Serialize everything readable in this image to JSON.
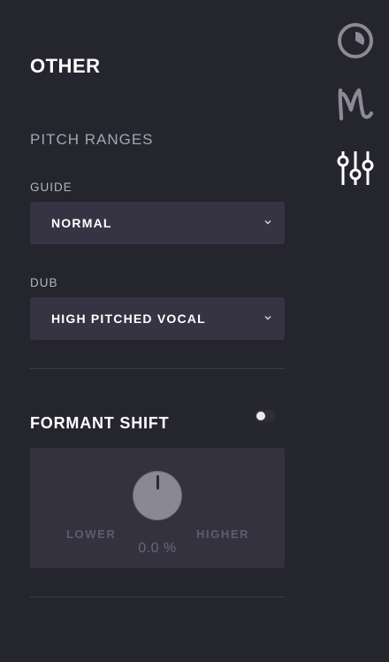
{
  "panel": {
    "title": "OTHER"
  },
  "pitch_ranges": {
    "title": "PITCH RANGES",
    "guide": {
      "label": "GUIDE",
      "value": "NORMAL"
    },
    "dub": {
      "label": "DUB",
      "value": "HIGH PITCHED VOCAL"
    }
  },
  "formant_shift": {
    "title": "FORMANT SHIFT",
    "enabled": false,
    "lower_label": "LOWER",
    "higher_label": "HIGHER",
    "value": "0.0 %"
  },
  "sidebar": {
    "icons": [
      "clock-icon",
      "waveform-m-icon",
      "sliders-icon"
    ],
    "active": "sliders-icon"
  },
  "colors": {
    "background": "#25252e",
    "control": "#363342",
    "text_primary": "#ffffff",
    "text_muted": "#a6a6b3"
  }
}
